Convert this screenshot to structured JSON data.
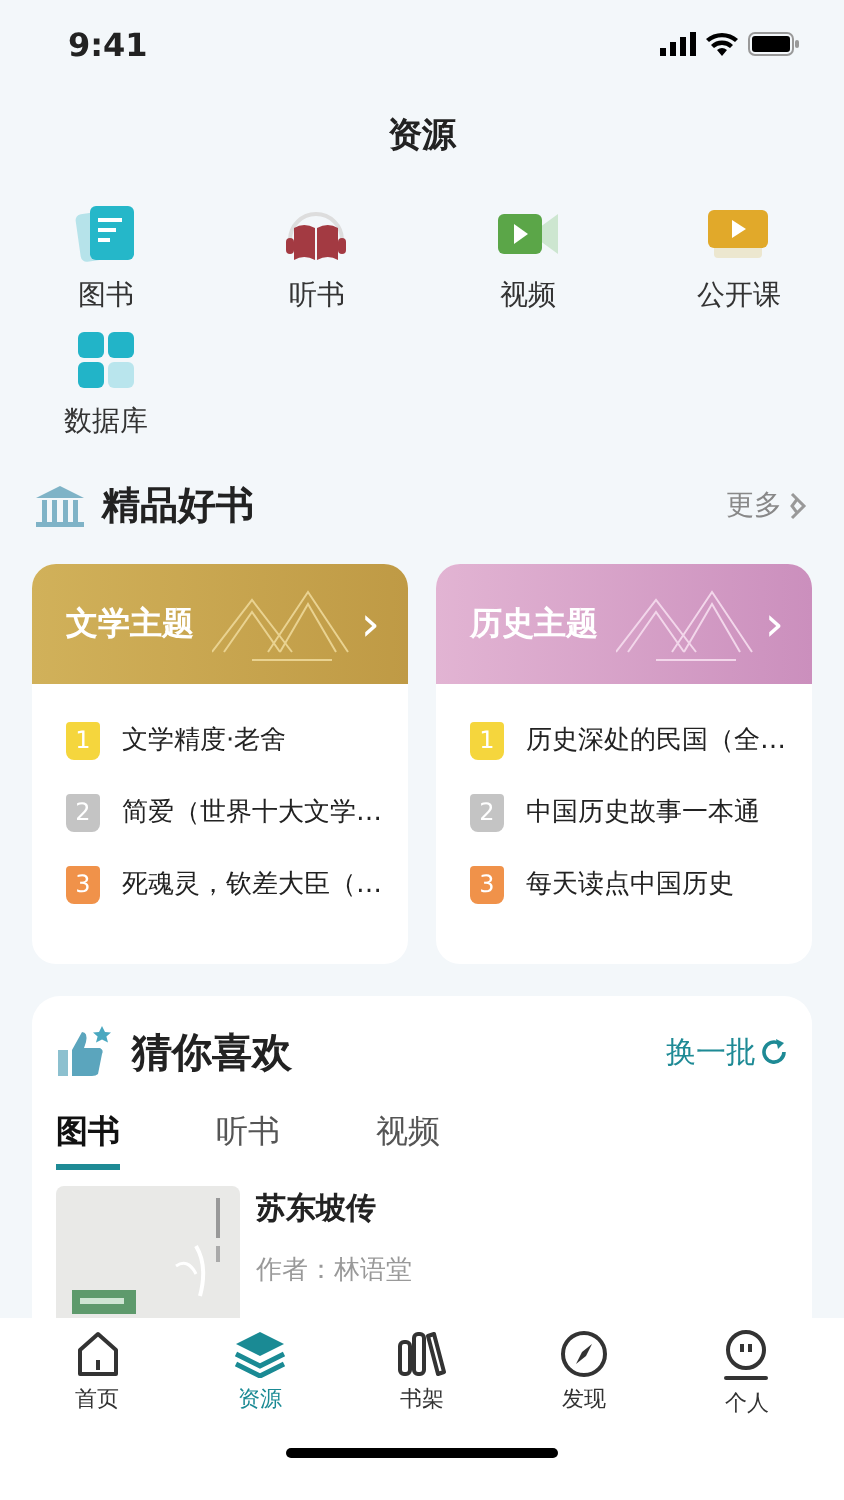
{
  "status_bar": {
    "time": "9:41"
  },
  "header": {
    "title": "资源"
  },
  "resources": [
    {
      "kind": "book",
      "label": "图书"
    },
    {
      "kind": "audio",
      "label": "听书"
    },
    {
      "kind": "video",
      "label": "视频"
    },
    {
      "kind": "course",
      "label": "公开课"
    },
    {
      "kind": "database",
      "label": "数据库"
    }
  ],
  "featured": {
    "title": "精品好书",
    "more": "更多",
    "themes": [
      {
        "kind": "literature",
        "title": "文学主题",
        "chevron": "›",
        "items": [
          {
            "rank": "1",
            "color": "#f5d63d",
            "title": "文学精度·老舍"
          },
          {
            "rank": "2",
            "color": "#c4c4c4",
            "title": "简爱（世界十大文学…"
          },
          {
            "rank": "3",
            "color": "#f0924a",
            "title": "死魂灵，钦差大臣（…"
          }
        ]
      },
      {
        "kind": "history",
        "title": "历史主题",
        "chevron": "›",
        "items": [
          {
            "rank": "1",
            "color": "#f5d63d",
            "title": "历史深处的民国（全…"
          },
          {
            "rank": "2",
            "color": "#c4c4c4",
            "title": "中国历史故事一本通"
          },
          {
            "rank": "3",
            "color": "#f0924a",
            "title": "每天读点中国历史"
          }
        ]
      }
    ]
  },
  "recommend": {
    "title": "猜你喜欢",
    "refresh": "换一批",
    "tabs": [
      {
        "label": "图书",
        "selected": true
      },
      {
        "label": "听书",
        "selected": false
      },
      {
        "label": "视频",
        "selected": false
      }
    ],
    "books": [
      {
        "title": "苏东坡传",
        "author": "作者：林语堂"
      }
    ]
  },
  "tab_bar": [
    {
      "kind": "home",
      "label": "首页",
      "selected": false
    },
    {
      "kind": "layers",
      "label": "资源",
      "selected": true
    },
    {
      "kind": "shelf",
      "label": "书架",
      "selected": false
    },
    {
      "kind": "compass",
      "label": "发现",
      "selected": false
    },
    {
      "kind": "person",
      "label": "个人",
      "selected": false
    }
  ]
}
